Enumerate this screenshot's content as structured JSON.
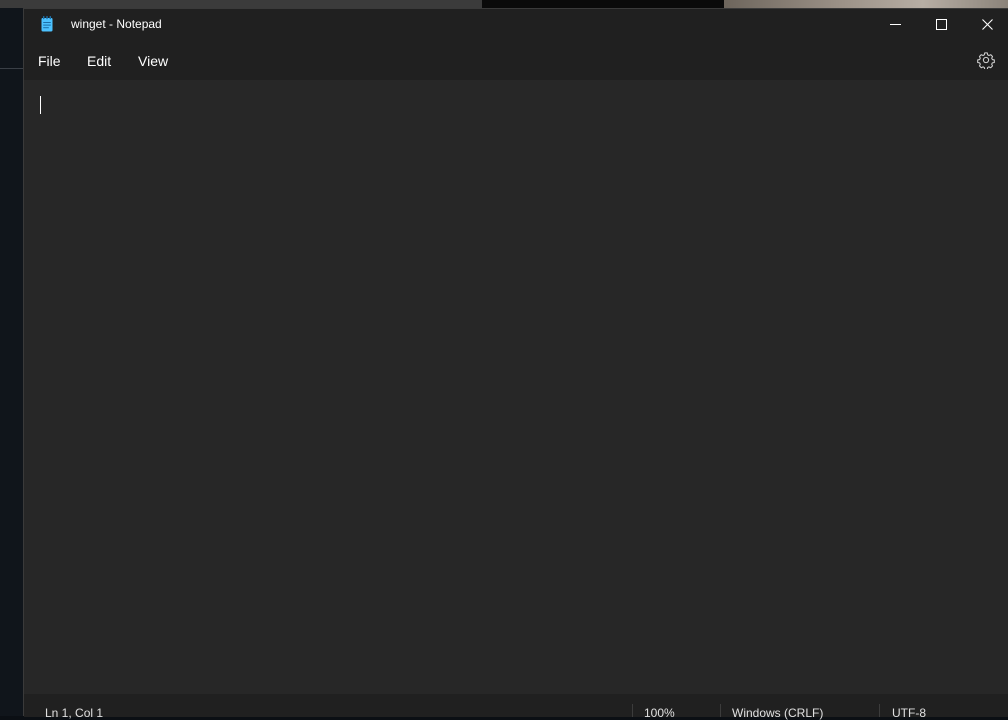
{
  "window": {
    "title": "winget - Notepad"
  },
  "titlebar": {
    "icons": {
      "app": "notepad-icon",
      "minimize": "minimize-icon",
      "maximize": "maximize-icon",
      "close": "close-icon"
    }
  },
  "menu": {
    "items": [
      {
        "label": "File"
      },
      {
        "label": "Edit"
      },
      {
        "label": "View"
      }
    ],
    "settings_icon": "gear-icon"
  },
  "editor": {
    "content": ""
  },
  "status": {
    "position": "Ln 1, Col 1",
    "zoom": "100%",
    "line_ending": "Windows (CRLF)",
    "encoding": "UTF-8"
  },
  "colors": {
    "titlebar_bg": "#202020",
    "editor_bg": "#272727",
    "text": "#ffffff",
    "app_icon_accent": "#4cc2ff"
  }
}
